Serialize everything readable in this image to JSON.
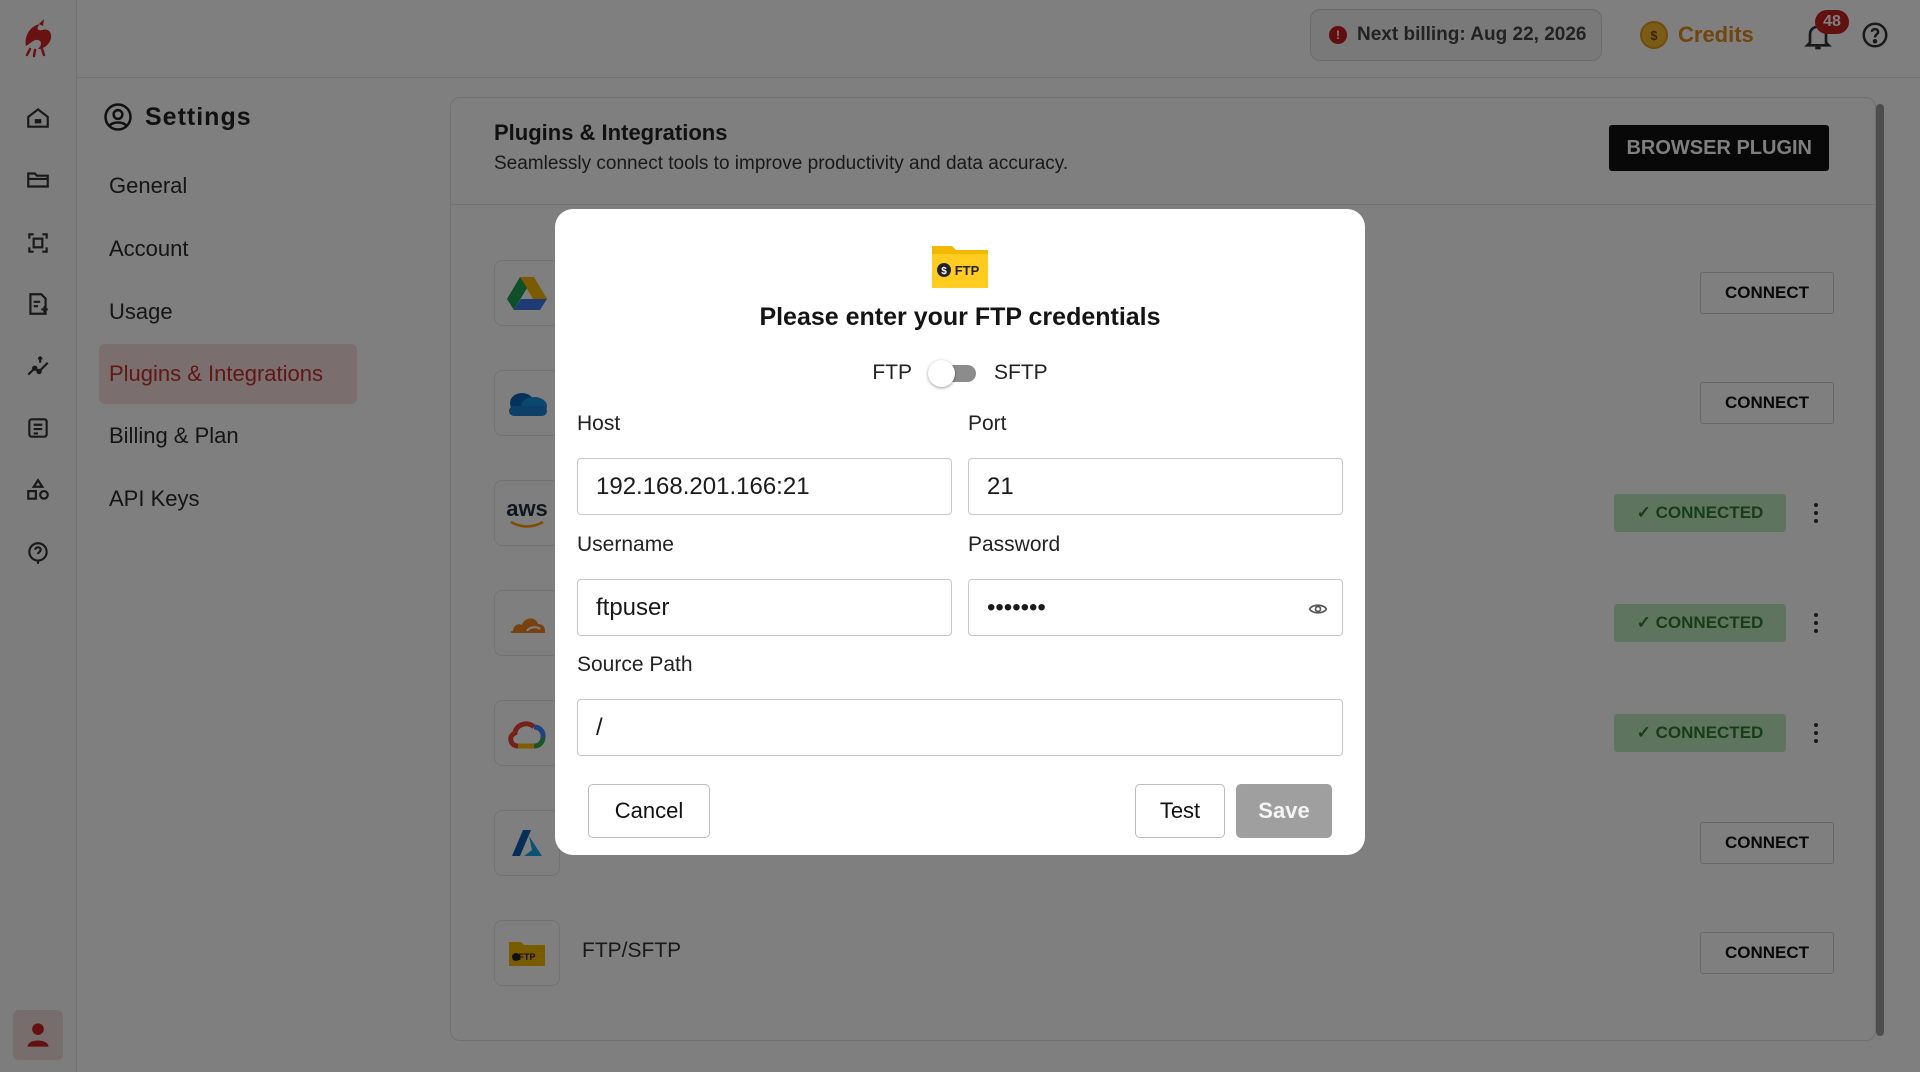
{
  "topbar": {
    "billing_icon": "alert-circle-icon",
    "billing_text": "Next billing: Aug 22, 2026",
    "credits_icon": "coin-icon",
    "credits_coin_symbol": "$",
    "credits_label": "Credits",
    "notification_icon": "bell-icon",
    "notification_count": "48",
    "help_icon": "help-circle-icon"
  },
  "rail": {
    "logo": "dragon-logo",
    "items": [
      "home-icon",
      "folder-icon",
      "scan-icon",
      "document-icon",
      "pipeline-icon",
      "list-icon",
      "shapes-icon",
      "help-circle-icon"
    ],
    "user_icon": "user-icon"
  },
  "settings": {
    "title": "Settings",
    "icon": "user-circle-icon",
    "nav": [
      {
        "label": "General",
        "active": false
      },
      {
        "label": "Account",
        "active": false
      },
      {
        "label": "Usage",
        "active": false
      },
      {
        "label": "Plugins & Integrations",
        "active": true
      },
      {
        "label": "Billing & Plan",
        "active": false
      },
      {
        "label": "API Keys",
        "active": false
      }
    ]
  },
  "panel": {
    "title": "Plugins & Integrations",
    "subtitle": "Seamlessly connect tools to improve productivity and data accuracy.",
    "browser_plugin_label": "BROWSER PLUGIN",
    "connect_label": "CONNECT",
    "connected_label": "✓ CONNECTED",
    "integrations": [
      {
        "icon": "google-drive-icon",
        "name": "",
        "status": "connect"
      },
      {
        "icon": "onedrive-icon",
        "name": "",
        "status": "connect"
      },
      {
        "icon": "aws-icon",
        "logo_text": "aws",
        "name": "",
        "status": "connected"
      },
      {
        "icon": "cloudflare-icon",
        "name": "",
        "status": "connected"
      },
      {
        "icon": "google-cloud-icon",
        "name": "",
        "status": "connected"
      },
      {
        "icon": "azure-icon",
        "name": "",
        "status": "connect"
      },
      {
        "icon": "ftp-folder-icon",
        "name": "FTP/SFTP",
        "status": "connect"
      }
    ]
  },
  "modal": {
    "icon": "ftp-folder-icon",
    "icon_text": "FTP",
    "icon_symbol": "$",
    "title": "Please enter your FTP credentials",
    "toggle_left": "FTP",
    "toggle_right": "SFTP",
    "host_label": "Host",
    "host_value": "192.168.201.166:21",
    "port_label": "Port",
    "port_value": "21",
    "username_label": "Username",
    "username_value": "ftpuser",
    "password_label": "Password",
    "password_value": "•••••••",
    "password_toggle_icon": "eye-icon",
    "source_path_label": "Source Path",
    "source_path_value": "/",
    "cancel_label": "Cancel",
    "test_label": "Test",
    "save_label": "Save"
  },
  "colors": {
    "accent": "#c0302c",
    "active_nav_bg": "#f6dcdc",
    "credits": "#e08a1c",
    "connected_bg": "#bfe8bf",
    "connected_text": "#2f7a2f",
    "save_disabled": "#9f9f9f"
  }
}
